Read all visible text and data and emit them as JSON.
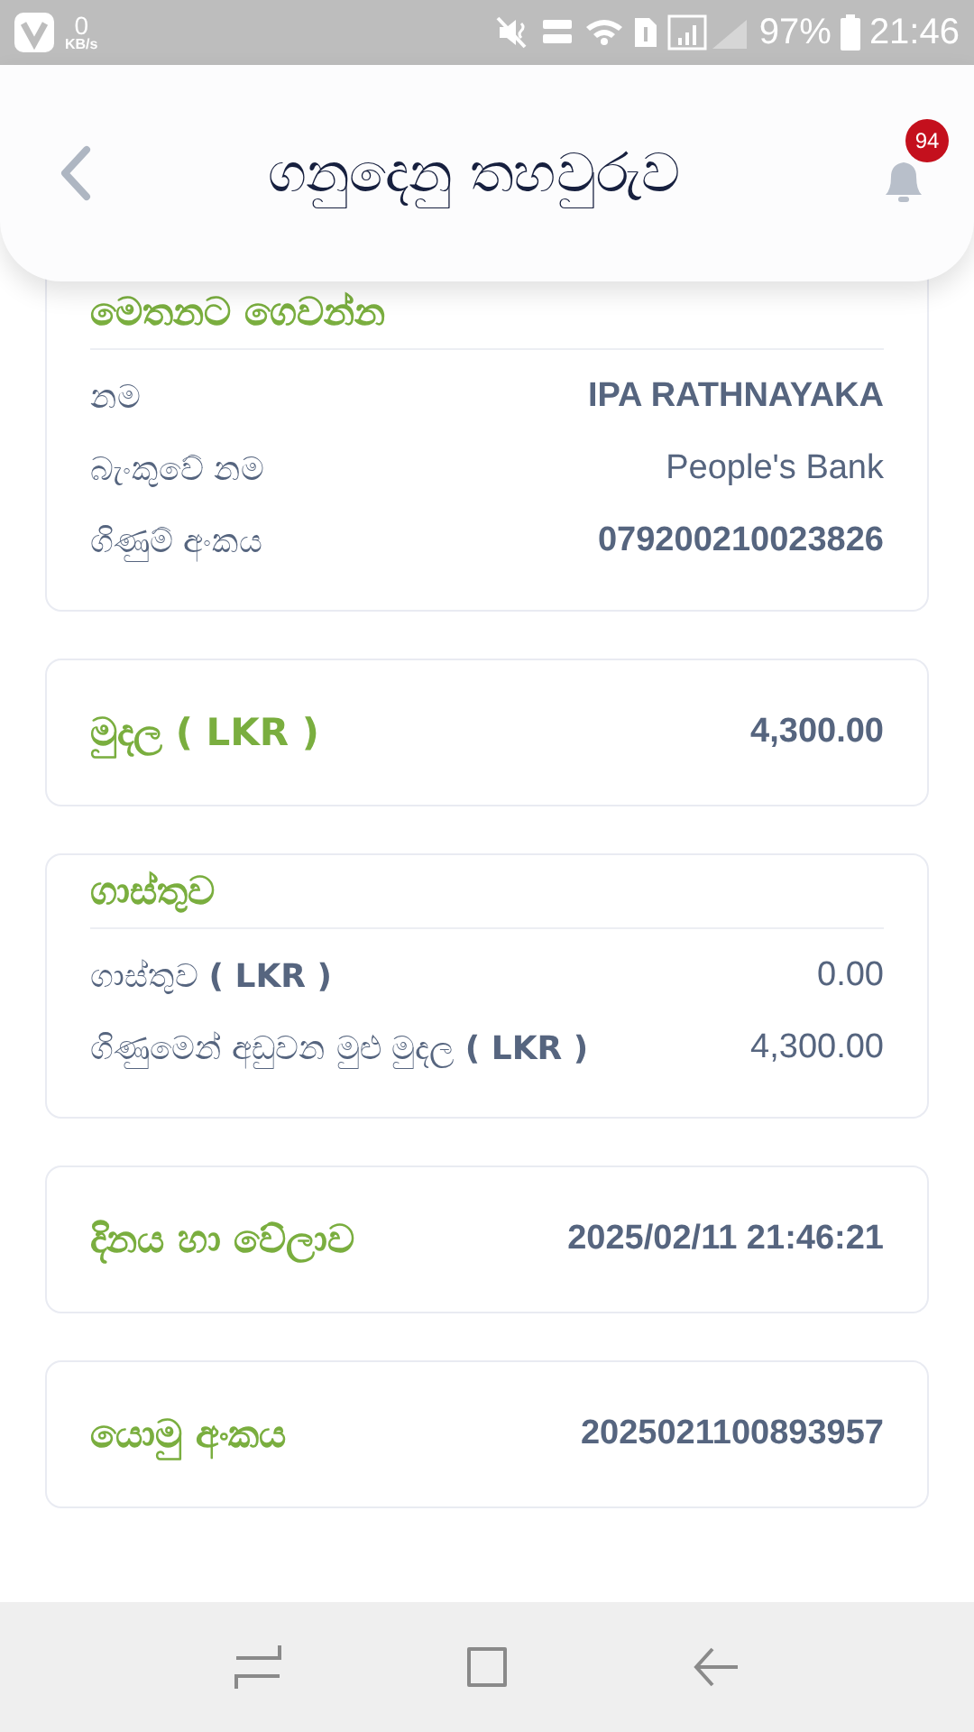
{
  "status_bar": {
    "data_speed": "0",
    "data_unit": "KB/s",
    "battery": "97%",
    "time": "21:46"
  },
  "header": {
    "title": "ගනුදෙනු තහවුරුව",
    "notification_count": "94"
  },
  "cards": [
    {
      "kind": "details",
      "title": "මෙතනට ගෙවන්න",
      "rows": [
        {
          "label": "නම",
          "value": "IPA RATHNAYAKA",
          "bold": true
        },
        {
          "label": "බැංකුවේ නම",
          "value": "People's Bank",
          "bold": false
        },
        {
          "label": "ගිණුම් අංකය",
          "value": "079200210023826",
          "bold": true
        }
      ]
    },
    {
      "kind": "summary",
      "label": "මුදල **( LKR )**",
      "value": "4,300.00"
    },
    {
      "kind": "details",
      "title": "ගාස්තුව",
      "rows": [
        {
          "label": "ගාස්තුව **( LKR )**",
          "value": "0.00",
          "bold": false
        },
        {
          "label": "ගිණුමෙන් අඩුවන මුළු මුදල **( LKR )**",
          "value": "4,300.00",
          "bold": false
        }
      ]
    },
    {
      "kind": "summary",
      "label": "දිනය හා වේලාව",
      "value": "2025/02/11 21:46:21"
    },
    {
      "kind": "summary",
      "label": "යොමු අංකය",
      "value": "2025021100893957"
    }
  ]
}
